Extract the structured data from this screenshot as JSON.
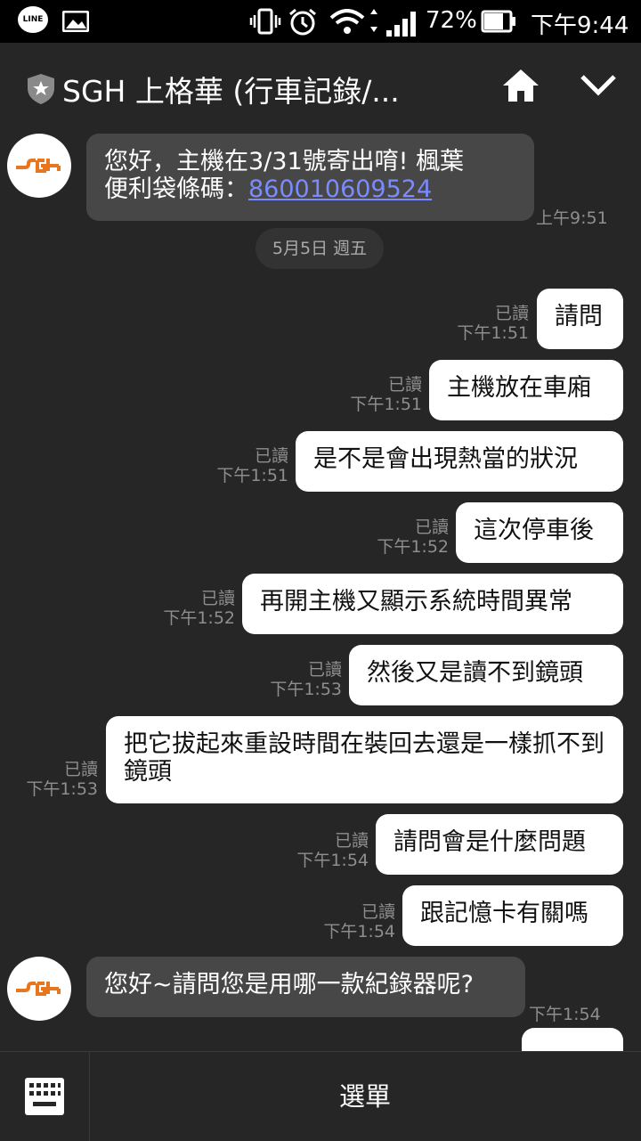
{
  "status_bar": {
    "line_label": "LINE",
    "battery": "72%",
    "time": "下午9:44"
  },
  "header": {
    "title": "SGH 上格華 (行車記錄/..."
  },
  "avatar_text": "SGH",
  "messages": {
    "m1": {
      "line1": "您好，主機在3/31號寄出唷! 楓葉",
      "line2_prefix": "便利袋條碼：",
      "link": "860010609524",
      "time": "上午9:51"
    },
    "date": "5月5日 週五",
    "read_label": "已讀",
    "o1": {
      "text": "請問",
      "time": "下午1:51"
    },
    "o2": {
      "text": "主機放在車廂",
      "time": "下午1:51"
    },
    "o3": {
      "text": "是不是會出現熱當的狀況",
      "time": "下午1:51"
    },
    "o4": {
      "text": "這次停車後",
      "time": "下午1:52"
    },
    "o5": {
      "text": "再開主機又顯示系統時間異常",
      "time": "下午1:52"
    },
    "o6": {
      "text": "然後又是讀不到鏡頭",
      "time": "下午1:53"
    },
    "o7": {
      "text": "把它拔起來重設時間在裝回去還是一樣抓不到鏡頭",
      "time": "下午1:53"
    },
    "o8": {
      "text": "請問會是什麼問題",
      "time": "下午1:54"
    },
    "o9": {
      "text": "跟記憶卡有關嗎",
      "time": "下午1:54"
    },
    "m2": {
      "text": "您好~請問您是用哪一款紀錄器呢?",
      "time": "下午1:54"
    }
  },
  "bottom": {
    "menu_label": "選單"
  },
  "colors": {
    "background": "#262626",
    "incoming_bubble": "#474747",
    "outgoing_bubble": "#ffffff",
    "link": "#7a8bff",
    "brand_orange": "#e8761e"
  }
}
